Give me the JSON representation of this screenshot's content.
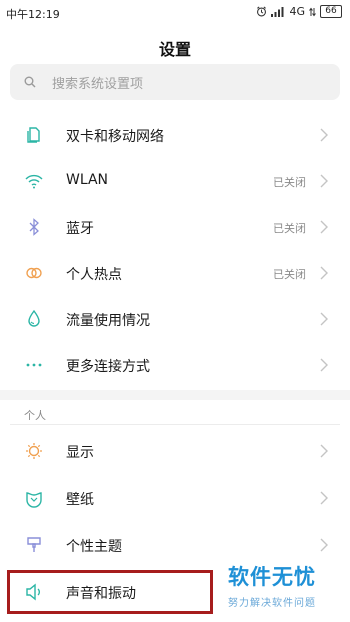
{
  "status_bar": {
    "time": "中午12:19",
    "network": "4G",
    "battery": "66"
  },
  "header": {
    "title": "设置"
  },
  "search": {
    "placeholder": "搜索系统设置项"
  },
  "connection_items": [
    {
      "label": "双卡和移动网络",
      "status": "",
      "icon": "sim-card-icon"
    },
    {
      "label": "WLAN",
      "status": "已关闭",
      "icon": "wifi-icon"
    },
    {
      "label": "蓝牙",
      "status": "已关闭",
      "icon": "bluetooth-icon"
    },
    {
      "label": "个人热点",
      "status": "已关闭",
      "icon": "hotspot-icon"
    },
    {
      "label": "流量使用情况",
      "status": "",
      "icon": "data-usage-icon"
    },
    {
      "label": "更多连接方式",
      "status": "",
      "icon": "more-dots-icon"
    }
  ],
  "personal_section": {
    "header": "个人",
    "items": [
      {
        "label": "显示",
        "icon": "display-sun-icon"
      },
      {
        "label": "壁纸",
        "icon": "wallpaper-icon"
      },
      {
        "label": "个性主题",
        "icon": "theme-brush-icon"
      },
      {
        "label": "声音和振动",
        "icon": "speaker-icon"
      }
    ]
  },
  "watermark": {
    "logo": "软件无忧",
    "subtitle": "努力解决软件问题"
  },
  "colors": {
    "accent_blue": "#1e90d6",
    "highlight_red": "#a61d1d",
    "icon_teal": "#2bb5a5",
    "icon_orange": "#f0a050"
  }
}
